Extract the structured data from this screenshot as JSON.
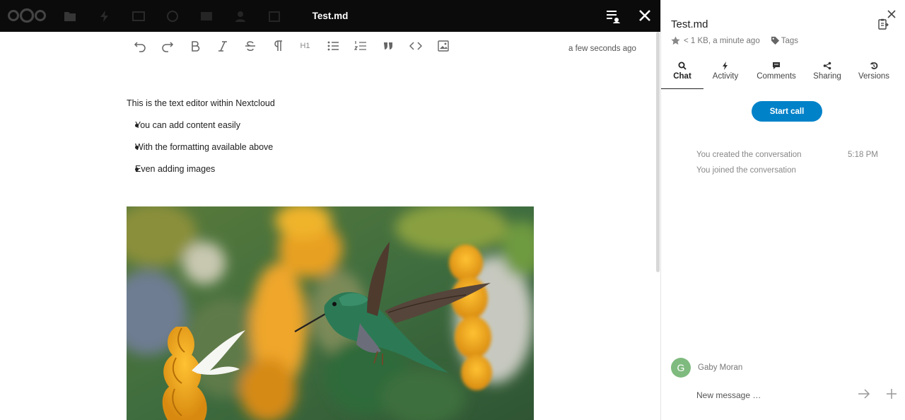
{
  "editor": {
    "title": "Test.md",
    "saved_status": "a few seconds ago",
    "toolbar": {
      "h1_label": "H1",
      "icons": [
        "undo-icon",
        "redo-icon",
        "bold-icon",
        "italic-icon",
        "strikethrough-icon",
        "paragraph-icon",
        "heading-icon",
        "bullet-list-icon",
        "numbered-list-icon",
        "blockquote-icon",
        "code-icon",
        "image-icon"
      ]
    },
    "content": {
      "paragraph": "This is the text editor within Nextcloud",
      "bullets": [
        "You can add content easily",
        "With the formatting available above",
        "Even adding images"
      ]
    }
  },
  "sidebar": {
    "file_name": "Test.md",
    "meta": "< 1 KB, a minute ago",
    "tags_label": "Tags",
    "tabs": [
      {
        "label": "Chat",
        "icon": "search-icon",
        "active": true
      },
      {
        "label": "Activity",
        "icon": "lightning-icon",
        "active": false
      },
      {
        "label": "Comments",
        "icon": "comment-icon",
        "active": false
      },
      {
        "label": "Sharing",
        "icon": "share-icon",
        "active": false
      },
      {
        "label": "Versions",
        "icon": "history-icon",
        "active": false
      }
    ],
    "start_call_label": "Start call",
    "system_messages": [
      "You created the conversation",
      "You joined the conversation"
    ],
    "system_time": "5:18 PM",
    "author_initial": "G",
    "author_name": "Gaby Moran",
    "message_placeholder": "New message …"
  },
  "colors": {
    "accent": "#0082c9",
    "topbar": "#0b0b0b",
    "avatar": "#7fba7f"
  }
}
